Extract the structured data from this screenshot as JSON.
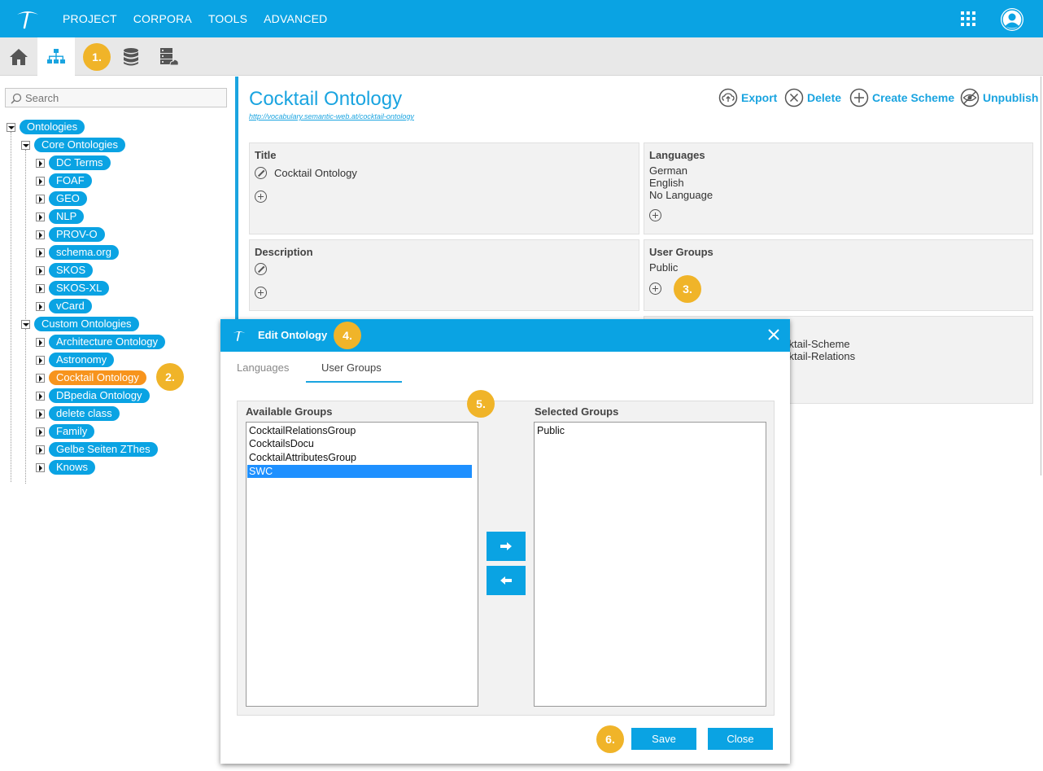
{
  "topbar": {
    "nav": [
      "PROJECT",
      "CORPORA",
      "TOOLS",
      "ADVANCED"
    ],
    "icons": [
      "apps-grid-icon",
      "user-icon"
    ]
  },
  "toolbar": {
    "icons": [
      "home-icon",
      "hierarchy-icon",
      "database-icon",
      "server-icon"
    ]
  },
  "badges": [
    "1.",
    "2.",
    "3.",
    "4.",
    "5.",
    "6."
  ],
  "sidebar": {
    "search_placeholder": "Search",
    "root": "Ontologies",
    "core_label": "Core Ontologies",
    "core": [
      "DC Terms",
      "FOAF",
      "GEO",
      "NLP",
      "PROV-O",
      "schema.org",
      "SKOS",
      "SKOS-XL",
      "vCard"
    ],
    "custom_label": "Custom Ontologies",
    "custom": [
      "Architecture Ontology",
      "Astronomy",
      "Cocktail Ontology",
      "DBpedia Ontology",
      "delete class",
      "Family",
      "Gelbe Seiten ZThes",
      "Knows"
    ],
    "selected": "Cocktail Ontology"
  },
  "main": {
    "title": "Cocktail Ontology",
    "url": "http://vocabulary.semantic-web.at/cocktail-ontology",
    "actions": [
      "Export",
      "Delete",
      "Create Scheme",
      "Unpublish"
    ],
    "title_label": "Title",
    "title_value": "Cocktail Ontology",
    "languages_label": "Languages",
    "languages": [
      "German",
      "English",
      "No Language"
    ],
    "description_label": "Description",
    "user_groups_label": "User Groups",
    "user_groups": [
      "Public"
    ],
    "schemes_partial": [
      "cktail-Scheme",
      "cktail-Relations"
    ]
  },
  "dialog": {
    "title": "Edit Ontology",
    "tabs": [
      "Languages",
      "User Groups"
    ],
    "active_tab": "User Groups",
    "available_label": "Available Groups",
    "available": [
      "CocktailRelationsGroup",
      "CocktailsDocu",
      "CocktailAttributesGroup",
      "SWC"
    ],
    "available_selected": "SWC",
    "selected_label": "Selected Groups",
    "selected": [
      "Public"
    ],
    "save": "Save",
    "close": "Close"
  },
  "colors": {
    "accent": "#0aa3e3",
    "selected_node": "#f7941d",
    "badge": "#f0b429",
    "list_selection": "#1e90ff"
  }
}
